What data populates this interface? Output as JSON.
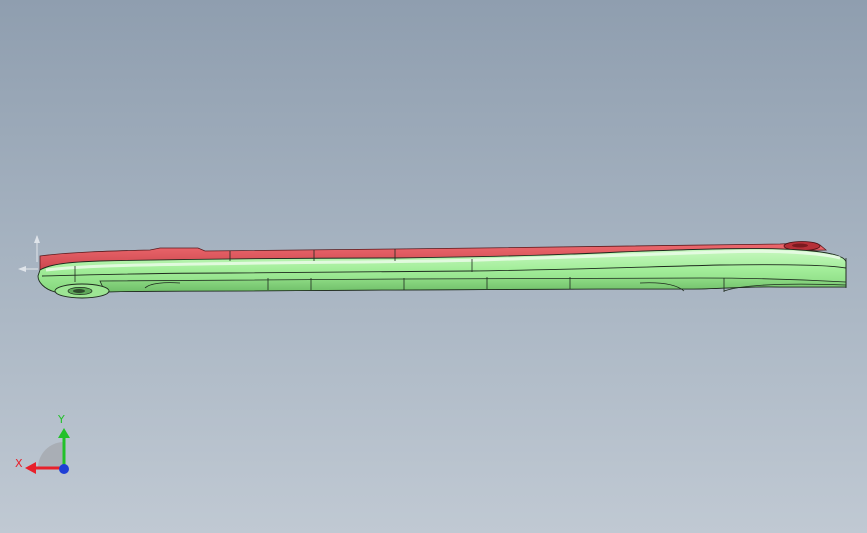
{
  "viewport": {
    "background_top": "#8f9eaf",
    "background_bottom": "#c0c9d3"
  },
  "model": {
    "upper_face_color": "#d9535a",
    "lower_face_color": "#a3ee9a",
    "edge_color": "#1e2a1e"
  },
  "triad": {
    "x_label": "X",
    "y_label": "Y",
    "x_color": "#e8202a",
    "y_color": "#22c12a",
    "z_color": "#1f3fd6",
    "x_icon": "x-axis-arrow-icon",
    "y_icon": "y-axis-arrow-icon",
    "z_icon": "z-axis-dot-icon"
  }
}
